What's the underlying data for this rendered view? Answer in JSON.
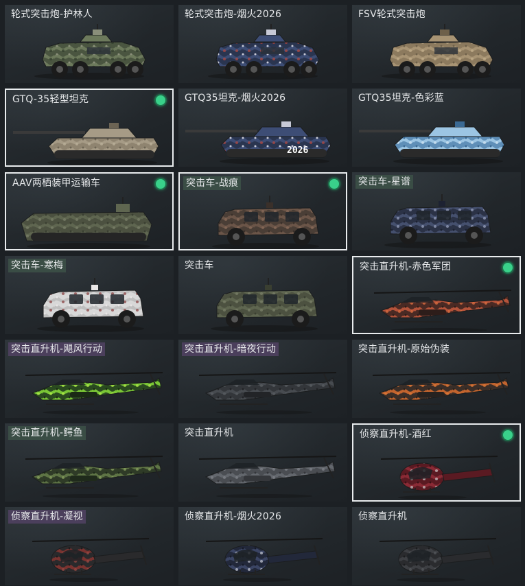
{
  "colors": {
    "selected_border": "#e9ecee",
    "equipped_dot": "#39d18a",
    "label_tag_purple": "#4b3f5c"
  },
  "items": [
    {
      "label": "轮式突击炮-护林人",
      "type": "wheeled-gun",
      "selected": false,
      "equipped": false,
      "tag": "none",
      "camo": "forest"
    },
    {
      "label": "轮式突击炮-烟火2026",
      "type": "wheeled-gun",
      "selected": false,
      "equipped": false,
      "tag": "none",
      "camo": "firework"
    },
    {
      "label": "FSV轮式突击炮",
      "type": "wheeled-gun",
      "selected": false,
      "equipped": false,
      "tag": "none",
      "camo": "desert"
    },
    {
      "label": "GTQ-35轻型坦克",
      "type": "tank",
      "selected": true,
      "equipped": true,
      "tag": "none",
      "camo": "sand"
    },
    {
      "label": "GTQ35坦克-烟火2026",
      "type": "tank",
      "selected": false,
      "equipped": false,
      "tag": "none",
      "camo": "firework",
      "decal": "2026"
    },
    {
      "label": "GTQ35坦克-色彩蓝",
      "type": "tank",
      "selected": false,
      "equipped": false,
      "tag": "none",
      "camo": "blue"
    },
    {
      "label": "AAV两栖装甲运输车",
      "type": "amphibious",
      "selected": true,
      "equipped": true,
      "tag": "none",
      "camo": "olive"
    },
    {
      "label": "突击车-战痕",
      "type": "truck",
      "selected": true,
      "equipped": true,
      "tag": "green",
      "camo": "rust"
    },
    {
      "label": "突击车-星谱",
      "type": "truck",
      "selected": false,
      "equipped": false,
      "tag": "green",
      "camo": "starry"
    },
    {
      "label": "突击车-寒梅",
      "type": "truck",
      "selected": false,
      "equipped": false,
      "tag": "green",
      "camo": "white"
    },
    {
      "label": "突击车",
      "type": "truck",
      "selected": false,
      "equipped": false,
      "tag": "none",
      "camo": "olive"
    },
    {
      "label": "突击直升机-赤色军团",
      "type": "attack-heli",
      "selected": true,
      "equipped": true,
      "tag": "none",
      "camo": "red"
    },
    {
      "label": "突击直升机-飓风行动",
      "type": "attack-heli",
      "selected": false,
      "equipped": false,
      "tag": "purple",
      "camo": "neon"
    },
    {
      "label": "突击直升机-暗夜行动",
      "type": "attack-heli",
      "selected": false,
      "equipped": false,
      "tag": "purple",
      "camo": "dark"
    },
    {
      "label": "突击直升机-原始伪装",
      "type": "attack-heli",
      "selected": false,
      "equipped": false,
      "tag": "none",
      "camo": "orange"
    },
    {
      "label": "突击直升机-鳄鱼",
      "type": "attack-heli",
      "selected": false,
      "equipped": false,
      "tag": "green",
      "camo": "croc"
    },
    {
      "label": "突击直升机",
      "type": "attack-heli",
      "selected": false,
      "equipped": false,
      "tag": "none",
      "camo": "gray"
    },
    {
      "label": "侦察直升机-酒红",
      "type": "scout-heli",
      "selected": true,
      "equipped": true,
      "tag": "none",
      "camo": "wine"
    },
    {
      "label": "侦察直升机-凝视",
      "type": "scout-heli",
      "selected": false,
      "equipped": false,
      "tag": "purple",
      "camo": "black-red"
    },
    {
      "label": "侦察直升机-烟火2026",
      "type": "scout-heli",
      "selected": false,
      "equipped": false,
      "tag": "none",
      "camo": "navy"
    },
    {
      "label": "侦察直升机",
      "type": "scout-heli",
      "selected": false,
      "equipped": false,
      "tag": "none",
      "camo": "black"
    }
  ]
}
